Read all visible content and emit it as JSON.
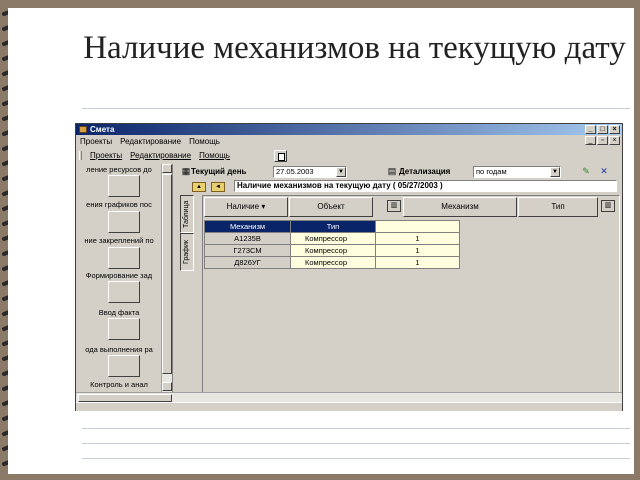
{
  "slide_title": "Наличие механизмов на текущую дату",
  "window": {
    "title": "Смета",
    "menu_top": [
      "Проекты",
      "Редактирование",
      "Помощь"
    ],
    "menu_second": [
      "Проекты",
      "Редактирование",
      "Помощь"
    ]
  },
  "left_panel": {
    "items": [
      "ление ресурсов до",
      "ения графиков пос",
      "ние закреплений по",
      "Формирование зад",
      "Ввод факта",
      "ода выполнения ра",
      "Контроль и анал"
    ]
  },
  "toolbar": {
    "current_day_label": "Текущий день",
    "current_day_value": "27.05.2003",
    "detail_label": "Детализация",
    "detail_value": "по годам"
  },
  "path_text": "Наличие механизмов на текущую дату ( 05/27/2003 )",
  "vertical_tabs": [
    "Таблица",
    "График"
  ],
  "pivot": {
    "row_field": "Наличие",
    "col_field_1": "Объект",
    "col_field_2": "Механизм",
    "col_field_3": "Тип"
  },
  "table": {
    "headers": [
      "Механизм",
      "Тип",
      ""
    ],
    "rows": [
      {
        "mechanism": "А1235В",
        "type": "Компрессор",
        "value": "1"
      },
      {
        "mechanism": "Г273СМ",
        "type": "Компрессор",
        "value": "1"
      },
      {
        "mechanism": "Д826УГ",
        "type": "Компрессор",
        "value": "1"
      }
    ]
  },
  "colors": {
    "background": "#8b7a68",
    "titlebar": "#0a246a",
    "table_header": "#0a246a",
    "cell_highlight": "#ffffe0"
  }
}
